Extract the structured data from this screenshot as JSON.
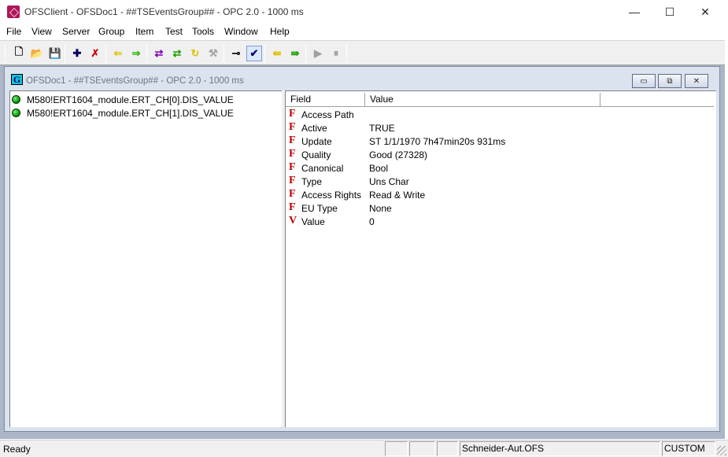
{
  "window": {
    "title": "OFSClient - OFSDoc1 - ##TSEventsGroup## - OPC 2.0 - 1000 ms",
    "minimize_symbol": "—",
    "maximize_symbol": "☐",
    "close_symbol": "✕"
  },
  "menu": [
    "File",
    "View",
    "Server",
    "Group",
    "Item",
    "Test",
    "Tools",
    "Window",
    "Help"
  ],
  "toolbar": {
    "buttons": [
      {
        "icon": "new-file-icon",
        "glyph": "🗋",
        "color": "#000000"
      },
      {
        "icon": "open-folder-icon",
        "glyph": "📂",
        "color": "#c8a000"
      },
      {
        "icon": "save-icon",
        "glyph": "💾",
        "color": "#000000"
      },
      {
        "icon": "add-icon",
        "glyph": "✚",
        "color": "#000060"
      },
      {
        "icon": "remove-icon",
        "glyph": "✗",
        "color": "#d00000"
      },
      {
        "icon": "arrow-left-yellow-icon",
        "glyph": "⇐",
        "color": "#e0c000"
      },
      {
        "icon": "arrow-right-green-icon",
        "glyph": "⇒",
        "color": "#20b000"
      },
      {
        "icon": "swap-purple-icon",
        "glyph": "⇄",
        "color": "#8000c0"
      },
      {
        "icon": "swap-green-icon",
        "glyph": "⇄",
        "color": "#20a000"
      },
      {
        "icon": "refresh-icon",
        "glyph": "↻",
        "color": "#e0c000"
      },
      {
        "icon": "disabled-tool-icon",
        "glyph": "⚒",
        "color": "#a0a0a0"
      },
      {
        "icon": "connect-icon",
        "glyph": "⊸",
        "color": "#000000"
      },
      {
        "icon": "check-icon",
        "glyph": "✔",
        "color": "#000080"
      },
      {
        "icon": "read-icon",
        "glyph": "⇚",
        "color": "#e0c000"
      },
      {
        "icon": "write-icon",
        "glyph": "⇛",
        "color": "#20a000"
      },
      {
        "icon": "play-icon",
        "glyph": "▶",
        "color": "#a0a0a0"
      },
      {
        "icon": "pause-icon",
        "glyph": "⏸",
        "color": "#a0a0a0"
      }
    ]
  },
  "child_window": {
    "icon_letter": "G",
    "title": "OFSDoc1 - ##TSEventsGroup## - OPC 2.0 - 1000 ms",
    "minimize_symbol": "▭",
    "restore_symbol": "⧉",
    "close_symbol": "✕"
  },
  "tree": {
    "items": [
      {
        "label": "M580!ERT1604_module.ERT_CH[0].DIS_VALUE",
        "status_color": "#0a9a0a"
      },
      {
        "label": "M580!ERT1604_module.ERT_CH[1].DIS_VALUE",
        "status_color": "#0a9a0a"
      }
    ]
  },
  "properties": {
    "columns": [
      "Field",
      "Value",
      ""
    ],
    "rows": [
      {
        "icon": "F",
        "field": "Access Path",
        "value": ""
      },
      {
        "icon": "F",
        "field": "Active",
        "value": "TRUE"
      },
      {
        "icon": "F",
        "field": "Update",
        "value": "ST 1/1/1970 7h47min20s 931ms"
      },
      {
        "icon": "F",
        "field": "Quality",
        "value": "Good (27328)"
      },
      {
        "icon": "F",
        "field": "Canonical",
        "value": "Bool"
      },
      {
        "icon": "F",
        "field": "Type",
        "value": "Uns Char"
      },
      {
        "icon": "F",
        "field": "Access Rights",
        "value": "Read & Write"
      },
      {
        "icon": "F",
        "field": "EU Type",
        "value": "None"
      },
      {
        "icon": "V",
        "field": "Value",
        "value": "0"
      }
    ]
  },
  "status": {
    "ready": "Ready",
    "server": "Schneider-Aut.OFS",
    "mode": "CUSTOM"
  }
}
